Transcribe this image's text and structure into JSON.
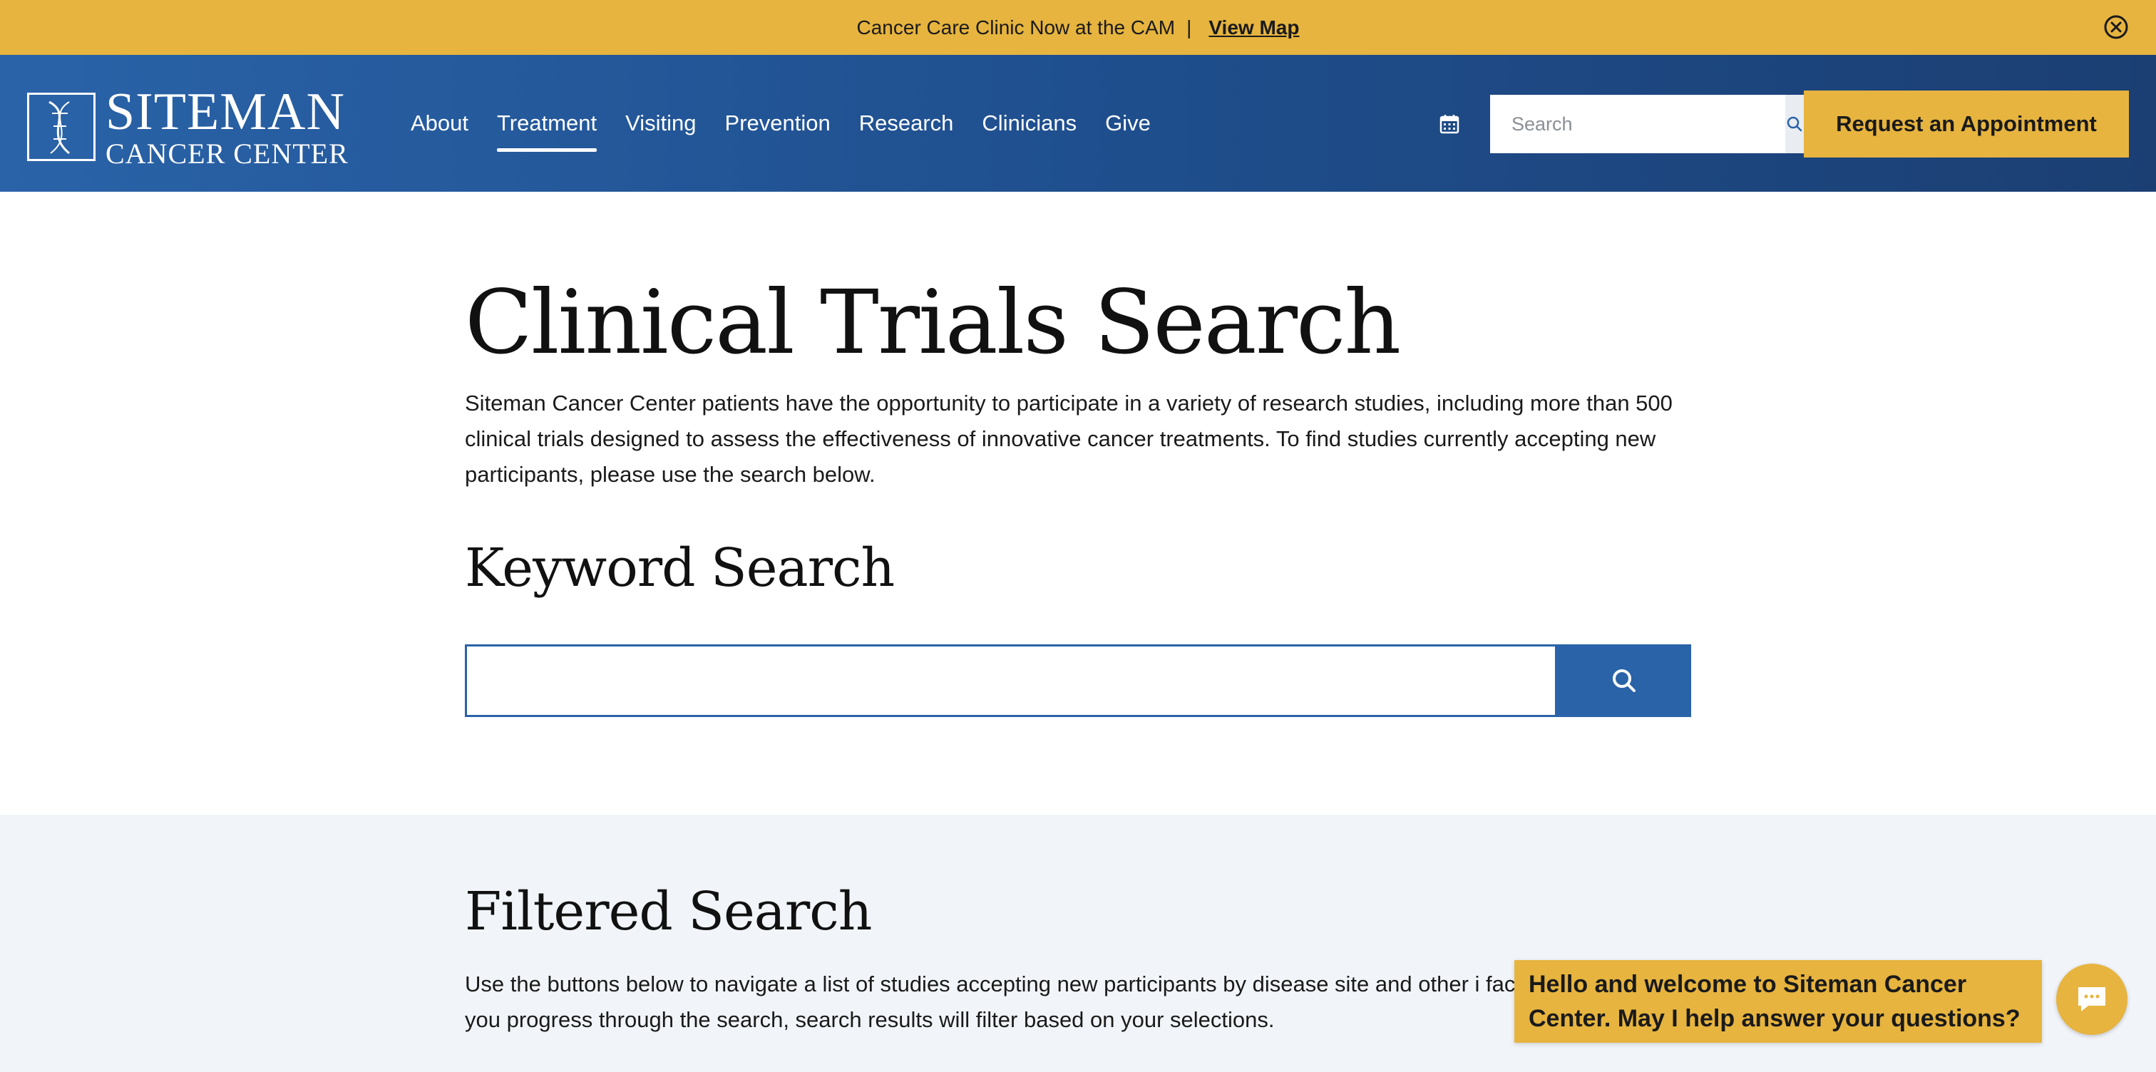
{
  "announcement": {
    "message": "Cancer Care Clinic Now at the CAM",
    "separator": "|",
    "link": "View Map"
  },
  "header": {
    "logo_line1": "SITEMAN",
    "logo_line2": "CANCER CENTER",
    "nav": [
      "About",
      "Treatment",
      "Visiting",
      "Prevention",
      "Research",
      "Clinicians",
      "Give"
    ],
    "active_nav": "Treatment",
    "search_placeholder": "Search",
    "cta": "Request an Appointment"
  },
  "main": {
    "title": "Clinical Trials Search",
    "intro": "Siteman Cancer Center patients have the opportunity to participate in a variety of research studies, including more than 500 clinical trials designed to assess the effectiveness of innovative cancer treatments. To find studies currently accepting new participants, please use the search below.",
    "keyword_title": "Keyword Search",
    "keyword_value": ""
  },
  "filtered": {
    "title": "Filtered Search",
    "description": "Use the buttons below to navigate a list of studies accepting new participants by disease site and other i factors. As you progress through the search, search results will filter based on your selections."
  },
  "chat": {
    "message": "Hello and welcome to Siteman Cancer Center. May I help answer your questions?"
  },
  "colors": {
    "accent_gold": "#e6b43f",
    "header_blue": "#2a63a8",
    "header_blue_dark": "#1b3f73",
    "section_bg": "#f1f4f8"
  },
  "icons": [
    "close-circle-icon",
    "calendar-icon",
    "search-icon",
    "chat-icon",
    "dna-logo-icon"
  ]
}
